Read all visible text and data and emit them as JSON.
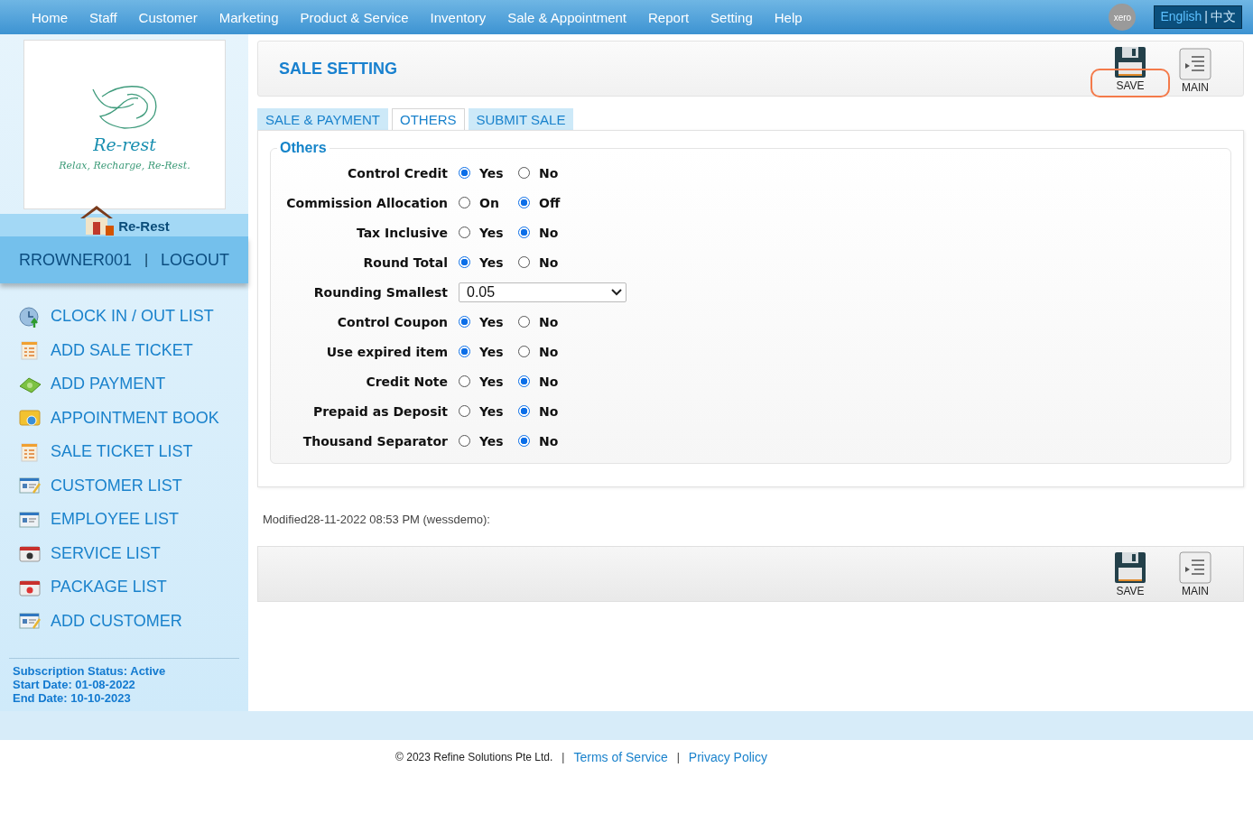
{
  "nav": {
    "items": [
      "Home",
      "Staff",
      "Customer",
      "Marketing",
      "Product & Service",
      "Inventory",
      "Sale & Appointment",
      "Report",
      "Setting",
      "Help"
    ],
    "xero": "xero",
    "language": {
      "options": [
        {
          "label": "English",
          "selected": true
        },
        {
          "label": "中文",
          "selected": false
        }
      ],
      "separator": "|"
    }
  },
  "sidebar": {
    "logo": {
      "name": "Re-rest",
      "tagline": "Relax, Recharge, Re-Rest."
    },
    "shop": "Re-Rest",
    "user": "RROWNER001",
    "separator": "|",
    "logout": "LOGOUT",
    "items": [
      {
        "label": "CLOCK IN / OUT LIST",
        "kind": "clock"
      },
      {
        "label": "ADD SALE TICKET",
        "kind": "ticket"
      },
      {
        "label": "ADD PAYMENT",
        "kind": "money"
      },
      {
        "label": "APPOINTMENT BOOK",
        "kind": "book"
      },
      {
        "label": "SALE TICKET LIST",
        "kind": "ticket"
      },
      {
        "label": "CUSTOMER LIST",
        "kind": "card"
      },
      {
        "label": "EMPLOYEE LIST",
        "kind": "employee"
      },
      {
        "label": "SERVICE LIST",
        "kind": "service"
      },
      {
        "label": "PACKAGE LIST",
        "kind": "package"
      },
      {
        "label": "ADD CUSTOMER",
        "kind": "card"
      }
    ],
    "subscription": [
      "Subscription Status: Active",
      "Start Date: 01-08-2022",
      "End Date: 10-10-2023"
    ]
  },
  "header": {
    "title": "SALE SETTING",
    "save": {
      "label": "SAVE",
      "highlighted": true
    },
    "main": "MAIN"
  },
  "tabs": [
    {
      "label": "SALE & PAYMENT",
      "selected": false
    },
    {
      "label": "OTHERS",
      "selected": true
    },
    {
      "label": "SUBMIT SALE",
      "selected": false
    }
  ],
  "section": {
    "title": "Others",
    "rows": [
      {
        "label": "Control Credit",
        "kind": "radio",
        "options": [
          {
            "label": "Yes",
            "selected": true
          },
          {
            "label": "No",
            "selected": false
          }
        ]
      },
      {
        "label": "Commission Allocation",
        "kind": "radio",
        "options": [
          {
            "label": "On",
            "selected": false
          },
          {
            "label": "Off",
            "selected": true
          }
        ]
      },
      {
        "label": "Tax Inclusive",
        "kind": "radio",
        "options": [
          {
            "label": "Yes",
            "selected": false
          },
          {
            "label": "No",
            "selected": true
          }
        ]
      },
      {
        "label": "Round Total",
        "kind": "radio",
        "options": [
          {
            "label": "Yes",
            "selected": true
          },
          {
            "label": "No",
            "selected": false
          }
        ]
      },
      {
        "label": "Rounding Smallest",
        "kind": "select",
        "value": "0.05"
      },
      {
        "label": "Control Coupon",
        "kind": "radio",
        "options": [
          {
            "label": "Yes",
            "selected": true
          },
          {
            "label": "No",
            "selected": false
          }
        ]
      },
      {
        "label": "Use expired item",
        "kind": "radio",
        "options": [
          {
            "label": "Yes",
            "selected": true
          },
          {
            "label": "No",
            "selected": false
          }
        ]
      },
      {
        "label": "Credit Note",
        "kind": "radio",
        "options": [
          {
            "label": "Yes",
            "selected": false
          },
          {
            "label": "No",
            "selected": true
          }
        ]
      },
      {
        "label": "Prepaid as Deposit",
        "kind": "radio",
        "options": [
          {
            "label": "Yes",
            "selected": false
          },
          {
            "label": "No",
            "selected": true
          }
        ]
      },
      {
        "label": "Thousand Separator",
        "kind": "radio",
        "options": [
          {
            "label": "Yes",
            "selected": false
          },
          {
            "label": "No",
            "selected": true
          }
        ]
      }
    ]
  },
  "modified": "Modified28-11-2022 08:53 PM (wessdemo):",
  "footer_bar": {
    "save": "SAVE",
    "main": "MAIN"
  },
  "footer": {
    "copyright": "© 2023 Refine Solutions Pte Ltd.",
    "sep1": "|",
    "terms": "Terms of Service",
    "sep2": "|",
    "privacy": "Privacy Policy"
  }
}
